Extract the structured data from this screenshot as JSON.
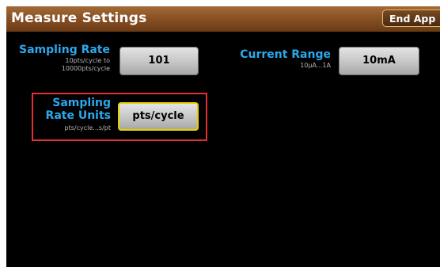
{
  "header": {
    "title": "Measure Settings",
    "end_app_label": "End App"
  },
  "sampling_rate": {
    "label": "Sampling Rate",
    "range_line1": "10pts/cycle to",
    "range_line2": "10000pts/cycle",
    "value": "101"
  },
  "current_range": {
    "label": "Current Range",
    "range": "10µA...1A",
    "value": "10mA"
  },
  "sampling_rate_units": {
    "label_line1": "Sampling",
    "label_line2": "Rate Units",
    "options": "pts/cycle...s/pt",
    "value": "pts/cycle"
  },
  "colors": {
    "title_bar": "#8a5226",
    "label_accent": "#2ba8ee",
    "selection_border": "#e8d000",
    "highlight_frame": "#e0312f"
  }
}
